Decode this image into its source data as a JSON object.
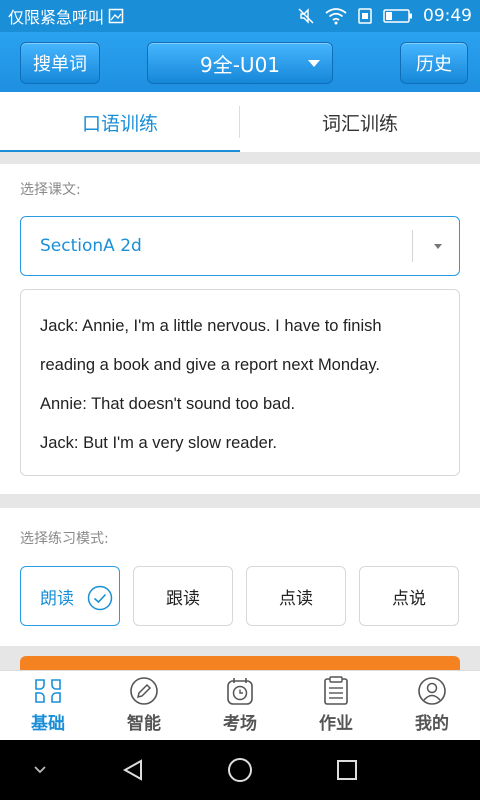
{
  "status_bar": {
    "carrier_text": "仅限紧急呼叫",
    "time": "09:49"
  },
  "header": {
    "search_label": "搜单词",
    "unit_selector": "9全-U01",
    "history_label": "历史"
  },
  "tabs": [
    {
      "label": "口语训练",
      "active": true
    },
    {
      "label": "词汇训练",
      "active": false
    }
  ],
  "lesson": {
    "label": "选择课文:",
    "selected": "SectionA 2d",
    "lines": [
      "Jack: Annie, I'm a little nervous. I have to finish",
      "reading a book and give a report next Monday.",
      "Annie: That doesn't sound too bad.",
      "Jack: But I'm a very slow reader."
    ]
  },
  "practice_mode": {
    "label": "选择练习模式:",
    "options": [
      {
        "label": "朗读",
        "selected": true
      },
      {
        "label": "跟读",
        "selected": false
      },
      {
        "label": "点读",
        "selected": false
      },
      {
        "label": "点说",
        "selected": false
      }
    ]
  },
  "bottom_nav": [
    {
      "label": "基础",
      "icon": "grid-icon",
      "active": true
    },
    {
      "label": "智能",
      "icon": "pencil-icon",
      "active": false
    },
    {
      "label": "考场",
      "icon": "clock-icon",
      "active": false
    },
    {
      "label": "作业",
      "icon": "clipboard-icon",
      "active": false
    },
    {
      "label": "我的",
      "icon": "user-icon",
      "active": false
    }
  ],
  "colors": {
    "primary": "#1a8fd8",
    "accent": "#f58220",
    "background": "#e6e6e6"
  }
}
